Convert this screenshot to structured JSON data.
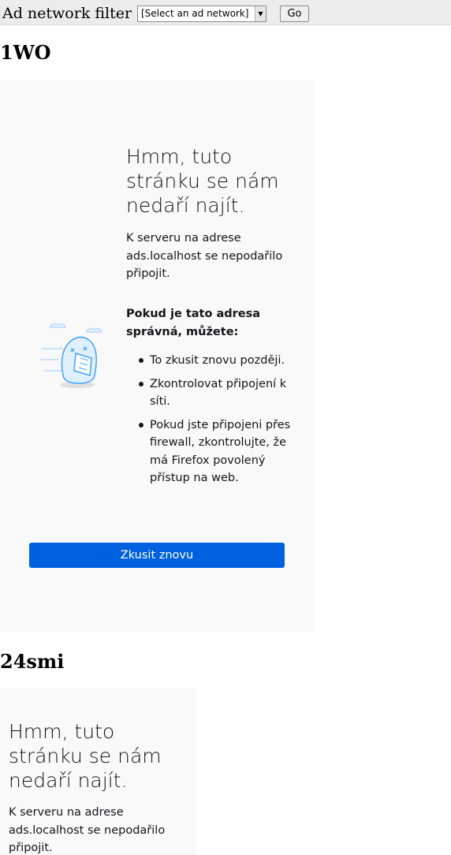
{
  "filter": {
    "label": "Ad network filter",
    "select_value": "[Select an ad network]",
    "go_label": "Go"
  },
  "sections": [
    {
      "heading": "1WO",
      "error": {
        "title": "Hmm, tuto stránku se nám nedaří najít.",
        "message": "K serveru na adrese ads.localhost se nepodařilo připojit.",
        "tips_heading": "Pokud je tato adresa správná, můžete:",
        "tips": [
          "To zkusit znovu později.",
          "Zkontrolovat připojení k síti.",
          "Pokud jste připojeni přes firewall, zkontrolujte, že má Firefox povolený přístup na web."
        ],
        "retry_label": "Zkusit znovu"
      }
    },
    {
      "heading": "24smi",
      "error": {
        "title": "Hmm, tuto stránku se nám nedaří najít.",
        "message": "K serveru na adrese ads.localhost se nepodařilo připojit."
      }
    }
  ],
  "colors": {
    "panel_background": "#f9f9f9",
    "primary_button": "#0061e0",
    "illustration": "#45a1ff"
  },
  "icons": {
    "illustration": "error-illustration-icon",
    "dropdown": "chevron-down-icon"
  }
}
